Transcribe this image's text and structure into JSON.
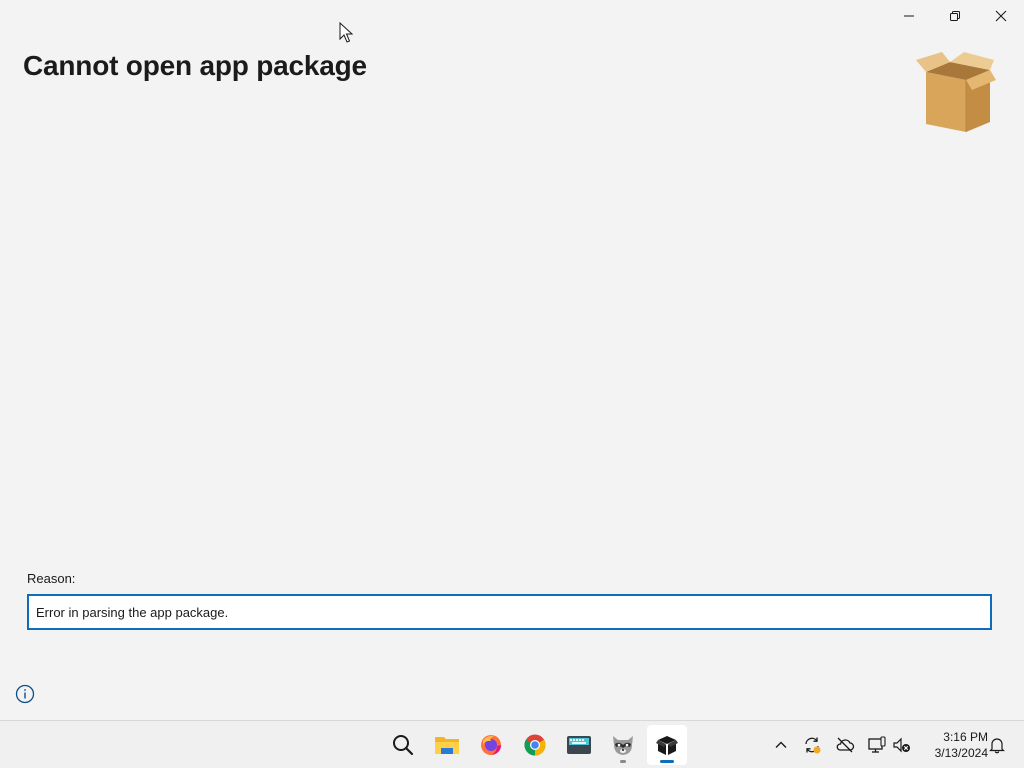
{
  "window": {
    "title": "Cannot open app package",
    "caption": {
      "minimize_icon": "minimize-icon",
      "maximize_icon": "restore-icon",
      "close_icon": "close-icon"
    }
  },
  "main": {
    "reason_label": "Reason:",
    "reason_value": "Error in parsing the app package.",
    "package_icon": "package-box-icon",
    "info_icon": "info-icon"
  },
  "taskbar": {
    "apps": [
      {
        "name": "search",
        "icon": "search-icon"
      },
      {
        "name": "file-explorer",
        "icon": "folder-icon"
      },
      {
        "name": "firefox",
        "icon": "firefox-icon"
      },
      {
        "name": "chrome",
        "icon": "chrome-icon"
      },
      {
        "name": "keyboard-app",
        "icon": "keyboard-icon"
      },
      {
        "name": "raccoon-app",
        "icon": "raccoon-icon"
      },
      {
        "name": "app-installer",
        "icon": "package-icon",
        "active": true
      }
    ],
    "tray": {
      "chevron_icon": "chevron-up-icon",
      "sync_icon": "sync-icon",
      "cloud_icon": "cloud-off-icon",
      "display_icon": "display-icon",
      "volume_icon": "volume-muted-icon",
      "notification_icon": "bell-icon"
    },
    "clock": {
      "time": "3:16 PM",
      "date": "3/13/2024"
    }
  },
  "colors": {
    "accent": "#0f6cbd",
    "background": "#f3f3f3",
    "box": "#d9a55a"
  }
}
